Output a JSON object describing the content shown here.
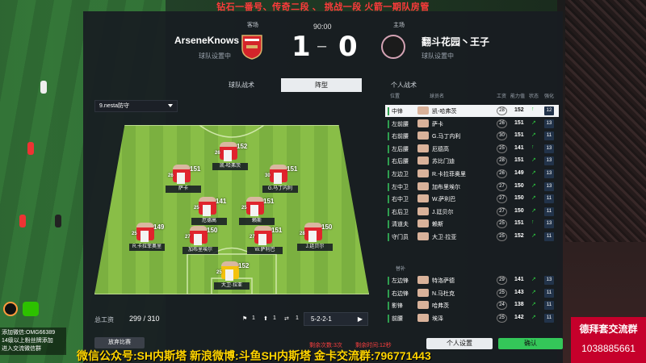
{
  "overlay_top": "钻石一番号、传奇二段 、 挑战一段 火箭一期队房管",
  "match": {
    "clock": "90:00",
    "home": {
      "side": "客场",
      "name": "ArseneKnows",
      "status": "球队设置中",
      "score": "1"
    },
    "away": {
      "side": "主场",
      "name": "翻斗花园丶王子",
      "status": "球队设置中",
      "score": "0"
    },
    "dash": "–"
  },
  "tabs": {
    "team_tactics": "球队战术",
    "formation": "阵型",
    "personal_tactics": "个人战术"
  },
  "tactic_select": "9.nesta防守",
  "formation_name": "5-2-2-1",
  "pitch_players": [
    {
      "lv": "26",
      "name": "凯-哈弗茨",
      "rating": "152"
    },
    {
      "lv": "26",
      "name": "萨卡",
      "rating": "151"
    },
    {
      "lv": "30",
      "name": "G.马丁内利",
      "rating": "151"
    },
    {
      "lv": "25",
      "name": "厄德高",
      "rating": "141"
    },
    {
      "lv": "25",
      "name": "R.卡拉菲奥里",
      "rating": "149"
    },
    {
      "lv": "27",
      "name": "W.萨利巴",
      "rating": "151"
    },
    {
      "lv": "27",
      "name": "加布里埃尔",
      "rating": "150"
    },
    {
      "lv": "28",
      "name": "J.廷贝尔",
      "rating": "150"
    },
    {
      "lv": "25",
      "name": "赖斯",
      "rating": "151"
    },
    {
      "lv": "25",
      "name": "大卫·拉亚",
      "rating": "152"
    }
  ],
  "wage": {
    "label": "总工资",
    "value": "299 / 310"
  },
  "bottom_counts": {
    "a": "1",
    "b": "1",
    "c": "1"
  },
  "buttons": {
    "forfeit": "放弃比赛",
    "personal_settings": "个人设置",
    "confirm": "确认"
  },
  "info": {
    "remaining_times": "剩余次数:3次",
    "remaining_time": "剩余时间:12秒"
  },
  "roster_headers": {
    "pos": "位置",
    "name": "球员名",
    "age": "工资",
    "rating": "能力值",
    "state": "状态",
    "form": "强化"
  },
  "roster": [
    {
      "pos": "中锋",
      "name": "凯-哈弗茨",
      "age": "28",
      "rating": "152",
      "arrow": "↑",
      "form": "12",
      "hl": true
    },
    {
      "pos": "左前腰",
      "name": "萨卡",
      "age": "26",
      "rating": "151",
      "arrow": "↗",
      "form": "13"
    },
    {
      "pos": "右前腰",
      "name": "G.马丁内利",
      "age": "30",
      "rating": "151",
      "arrow": "↗",
      "form": "11"
    },
    {
      "pos": "左后腰",
      "name": "厄德高",
      "age": "25",
      "rating": "141",
      "arrow": "↑",
      "form": "13"
    },
    {
      "pos": "右后腰",
      "name": "苏比门迪",
      "age": "28",
      "rating": "151",
      "arrow": "↗",
      "form": "13"
    },
    {
      "pos": "左边卫",
      "name": "R.卡拉菲奥里",
      "age": "26",
      "rating": "149",
      "arrow": "↗",
      "form": "13"
    },
    {
      "pos": "左中卫",
      "name": "加布里埃尔",
      "age": "27",
      "rating": "150",
      "arrow": "↗",
      "form": "13"
    },
    {
      "pos": "右中卫",
      "name": "W.萨利巴",
      "age": "27",
      "rating": "150",
      "arrow": "↗",
      "form": "11"
    },
    {
      "pos": "右后卫",
      "name": "J.廷贝尔",
      "age": "27",
      "rating": "150",
      "arrow": "↗",
      "form": "11"
    },
    {
      "pos": "清道夫",
      "name": "赖斯",
      "age": "25",
      "rating": "151",
      "arrow": "↑",
      "form": "13"
    },
    {
      "pos": "守门员",
      "name": "大卫·拉亚",
      "age": "25",
      "rating": "152",
      "arrow": "↗",
      "form": "11"
    }
  ],
  "subs_label": "替补",
  "subs": [
    {
      "pos": "左边锋",
      "name": "特洛萨德",
      "age": "29",
      "rating": "141",
      "arrow": "↗",
      "form": "13"
    },
    {
      "pos": "右边锋",
      "name": "N.马杜克",
      "age": "25",
      "rating": "143",
      "arrow": "↗",
      "form": "11"
    },
    {
      "pos": "影锋",
      "name": "哈弗茨",
      "age": "24",
      "rating": "138",
      "arrow": "↗",
      "form": "11"
    },
    {
      "pos": "前腰",
      "name": "埃泽",
      "age": "25",
      "rating": "142",
      "arrow": "↗",
      "form": "11"
    }
  ],
  "watermark": {
    "left_line1": "添加微信:OMG66389",
    "left_line2": "14级以上粉丝牌添加",
    "left_line3": "进入交流微信群",
    "bottom": "微信公众号:SH内斯塔   新浪微博:斗鱼SH内斯塔   金卡交流群:796771443",
    "right_title": "德拜套交流群",
    "right_number": "1038885661"
  },
  "colors": {
    "accent_green": "#34c759",
    "arsenal_red": "#e0242d",
    "panel": "#181c22"
  }
}
